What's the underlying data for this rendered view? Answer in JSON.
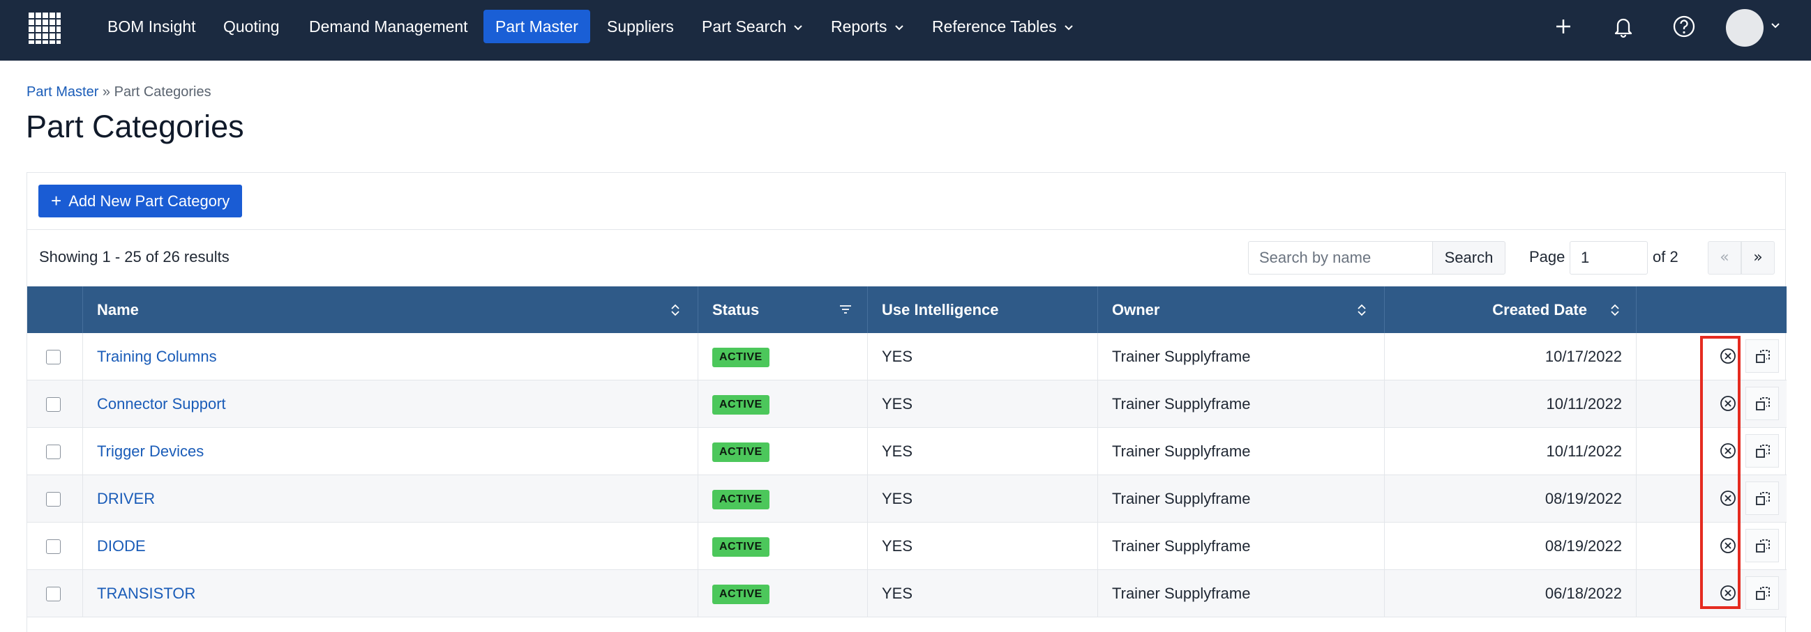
{
  "nav": {
    "items": [
      {
        "label": "BOM Insight"
      },
      {
        "label": "Quoting"
      },
      {
        "label": "Demand Management"
      },
      {
        "label": "Part Master",
        "active": true
      },
      {
        "label": "Suppliers"
      },
      {
        "label": "Part Search",
        "dropdown": true
      },
      {
        "label": "Reports",
        "dropdown": true
      },
      {
        "label": "Reference Tables",
        "dropdown": true
      }
    ],
    "icons": [
      "grid-logo-icon",
      "plus-icon",
      "bell-icon",
      "help-icon",
      "avatar",
      "chevron-down-icon"
    ]
  },
  "breadcrumb": {
    "parent": "Part Master",
    "separator": " » ",
    "current": "Part Categories"
  },
  "page": {
    "title": "Part Categories"
  },
  "toolbar": {
    "add_label": "Add New Part Category",
    "results_text": "Showing 1 - 25 of 26 results",
    "search_placeholder": "Search by name",
    "search_label": "Search",
    "page_label": "Page",
    "page_value": "1",
    "of_label": "of 2",
    "prev_label": "«",
    "next_label": "»"
  },
  "table": {
    "columns": [
      "Name",
      "Status",
      "Use Intelligence",
      "Owner",
      "Created Date"
    ],
    "rows": [
      {
        "name": "Training Columns",
        "status": "ACTIVE",
        "use_intelligence": "YES",
        "owner": "Trainer Supplyframe",
        "created": "10/17/2022"
      },
      {
        "name": "Connector Support",
        "status": "ACTIVE",
        "use_intelligence": "YES",
        "owner": "Trainer Supplyframe",
        "created": "10/11/2022"
      },
      {
        "name": "Trigger Devices",
        "status": "ACTIVE",
        "use_intelligence": "YES",
        "owner": "Trainer Supplyframe",
        "created": "10/11/2022"
      },
      {
        "name": "DRIVER",
        "status": "ACTIVE",
        "use_intelligence": "YES",
        "owner": "Trainer Supplyframe",
        "created": "08/19/2022"
      },
      {
        "name": "DIODE",
        "status": "ACTIVE",
        "use_intelligence": "YES",
        "owner": "Trainer Supplyframe",
        "created": "08/19/2022"
      },
      {
        "name": "TRANSISTOR",
        "status": "ACTIVE",
        "use_intelligence": "YES",
        "owner": "Trainer Supplyframe",
        "created": "06/18/2022"
      }
    ]
  },
  "colors": {
    "nav_bg": "#1b2a40",
    "active_nav": "#1a5fd6",
    "table_header": "#2f5a88",
    "badge_active": "#4cc75b",
    "link": "#1a5cb8",
    "highlight": "#e52b20"
  }
}
